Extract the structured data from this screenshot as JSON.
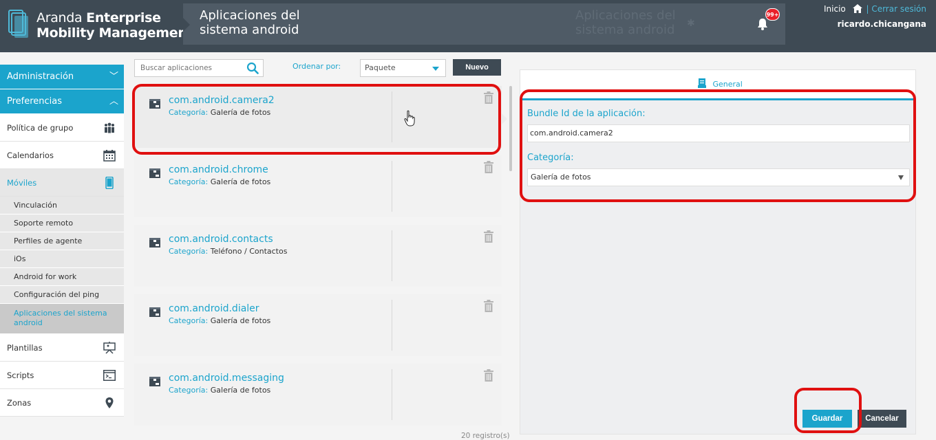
{
  "header": {
    "brand_light": "Aranda",
    "brand_bold": "Enterprise",
    "brand_line2": "Mobility Management",
    "page_title": "Aplicaciones del sistema android",
    "ghost_title": "Aplicaciones del sistema android",
    "notifications_badge": "99+",
    "home_link": "Inicio",
    "separator": "|",
    "logout_link": "Cerrar sesión",
    "username": "ricardo.chicangana"
  },
  "sidebar": {
    "sections": [
      {
        "label": "Administración",
        "chevron": "chevron-down-icon"
      },
      {
        "label": "Preferencias",
        "chevron": "chevron-up-icon"
      }
    ],
    "items": [
      {
        "label": "Política de grupo",
        "icon": "group-policy-icon"
      },
      {
        "label": "Calendarios",
        "icon": "calendar-icon"
      },
      {
        "label": "Móviles",
        "icon": "mobile-icon"
      }
    ],
    "subitems": [
      "Vinculación",
      "Soporte remoto",
      "Perfiles de agente",
      "iOs",
      "Android for work",
      "Configuración del ping",
      "Aplicaciones del sistema android"
    ],
    "bottom_items": [
      {
        "label": "Plantillas",
        "icon": "presentation-icon"
      },
      {
        "label": "Scripts",
        "icon": "terminal-icon"
      },
      {
        "label": "Zonas",
        "icon": "map-pin-icon"
      }
    ]
  },
  "toolbar": {
    "search_placeholder": "Buscar aplicaciones",
    "sort_label": "Ordenar por:",
    "sort_value": "Paquete",
    "new_button": "Nuevo"
  },
  "apps": [
    {
      "name": "com.android.camera2",
      "category_label": "Categoría:",
      "category": "Galería de fotos"
    },
    {
      "name": "com.android.chrome",
      "category_label": "Categoría:",
      "category": "Galería de fotos"
    },
    {
      "name": "com.android.contacts",
      "category_label": "Categoría:",
      "category": "Teléfono / Contactos"
    },
    {
      "name": "com.android.dialer",
      "category_label": "Categoría:",
      "category": "Galería de fotos"
    },
    {
      "name": "com.android.messaging",
      "category_label": "Categoría:",
      "category": "Galería de fotos"
    }
  ],
  "record_count": "20 registro(s)",
  "detail": {
    "tab_label": "General",
    "bundle_label": "Bundle Id de la aplicación:",
    "bundle_value": "com.android.camera2",
    "category_label": "Categoría:",
    "category_value": "Galería de fotos",
    "save_button": "Guardar",
    "cancel_button": "Cancelar"
  },
  "colors": {
    "accent": "#1ba4cc",
    "header_bg": "#3e4a54",
    "annotation": "#e01010"
  }
}
